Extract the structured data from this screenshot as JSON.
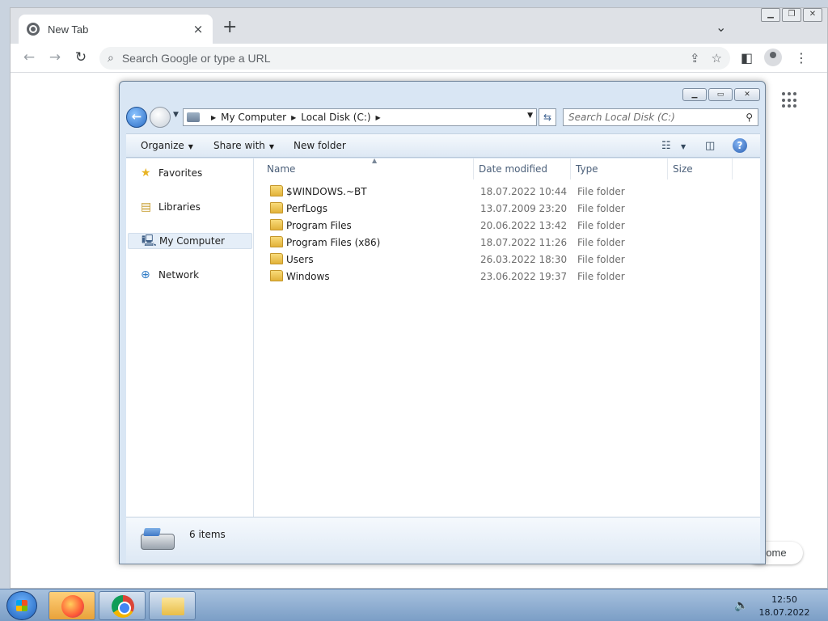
{
  "chrome": {
    "tab_title": "New Tab",
    "tab_close": "×",
    "new_tab": "+",
    "omnibox_placeholder": "Search Google or type a URL",
    "pill_text": "rome"
  },
  "explorer": {
    "breadcrumb": [
      "My Computer",
      "Local Disk (C:)"
    ],
    "search_placeholder": "Search Local Disk (C:)",
    "commands": {
      "organize": "Organize",
      "share_with": "Share with",
      "new_folder": "New folder"
    },
    "nav": {
      "favorites": "Favorites",
      "libraries": "Libraries",
      "my_computer": "My Computer",
      "network": "Network"
    },
    "columns": {
      "name": "Name",
      "date_modified": "Date modified",
      "type": "Type",
      "size": "Size"
    },
    "rows": [
      {
        "name": "$WINDOWS.~BT",
        "date": "18.07.2022 10:44",
        "type": "File folder"
      },
      {
        "name": "PerfLogs",
        "date": "13.07.2009 23:20",
        "type": "File folder"
      },
      {
        "name": "Program Files",
        "date": "20.06.2022 13:42",
        "type": "File folder"
      },
      {
        "name": "Program Files (x86)",
        "date": "18.07.2022 11:26",
        "type": "File folder"
      },
      {
        "name": "Users",
        "date": "26.03.2022 18:30",
        "type": "File folder"
      },
      {
        "name": "Windows",
        "date": "23.06.2022 19:37",
        "type": "File folder"
      }
    ],
    "status": "6 items"
  },
  "taskbar": {
    "time": "12:50",
    "date": "18.07.2022"
  }
}
